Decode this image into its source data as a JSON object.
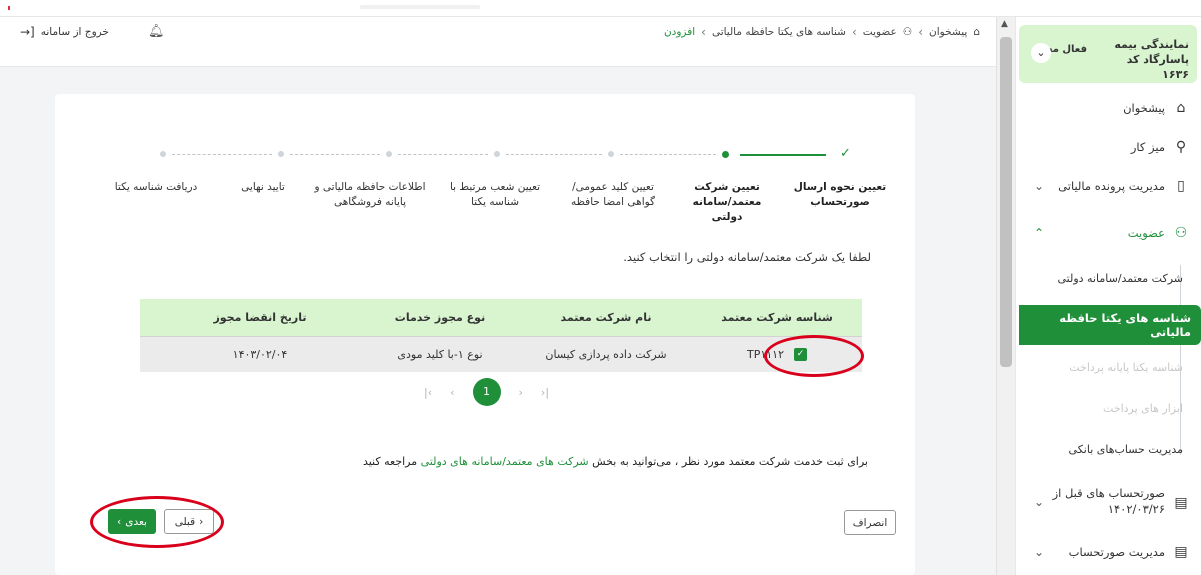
{
  "sidebar": {
    "agency_name": "نمایندگی بیمه پاسارگاد کد ۱۶۳۶",
    "agency_role": "فعال مجاز",
    "items": [
      {
        "label": "پیشخوان",
        "icon": "home-icon"
      },
      {
        "label": "میز کار",
        "icon": "workspace-icon"
      },
      {
        "label": "مدیریت پرونده مالیاتی",
        "icon": "file-icon"
      },
      {
        "label": "عضویت",
        "icon": "user-icon"
      },
      {
        "label": "صورتحساب های قبل از ۱۴۰۲/۰۳/۲۶",
        "icon": "invoice-icon"
      },
      {
        "label": "مدیریت صورتحساب",
        "icon": "invoice-icon"
      }
    ],
    "sub_items": [
      {
        "label": "شرکت معتمد/سامانه دولتی"
      },
      {
        "label": "شناسه های یکتا حافظه مالیاتی"
      },
      {
        "label": "شناسه یکتا پایانه پرداخت"
      },
      {
        "label": "ابزار های پرداخت"
      },
      {
        "label": "مدیریت حساب‌های بانکی"
      }
    ]
  },
  "header": {
    "logout_label": "خروج از سامانه",
    "breadcrumb": [
      "پیشخوان",
      "عضویت",
      "شناسه های یکتا حافظه مالیاتی",
      "افزودن"
    ]
  },
  "steps": [
    "تعیین نحوه ارسال صورتحساب",
    "تعیین شرکت معتمد/سامانه دولتی",
    "تعیین کلید عمومی/گواهی امضا حافظه",
    "تعیین شعب مرتبط با شناسه یکتا",
    "اطلاعات حافظه مالیاتی و پایانه فروشگاهی",
    "تایید نهایی",
    "دریافت شناسه یکتا"
  ],
  "instruction": "لطفا یک شرکت معتمد/سامانه دولتی را انتخاب کنید.",
  "table": {
    "headers": [
      "شناسه شرکت معتمد",
      "نام شرکت معتمد",
      "نوع مجوز خدمات",
      "تاریخ انقضا مجوز"
    ],
    "rows": [
      [
        "TP۱۱۱۲",
        "شرکت داده پردازی کیسان",
        "نوع ۱-با کلید مودی",
        "۱۴۰۳/۰۲/۰۴"
      ]
    ]
  },
  "pagination": {
    "current": "1"
  },
  "note": {
    "before": "برای ثبت خدمت شرکت معتمد مورد نظر ، می‌توانید به بخش",
    "link": "شرکت های معتمد/سامانه های دولتی",
    "after": "مراجعه کنید"
  },
  "buttons": {
    "next": "بعدی",
    "prev": "قبلی",
    "cancel": "انصراف"
  },
  "colors": {
    "accent": "#1f8f3a",
    "light_green": "#d9f5d0",
    "highlight": "#d9001b"
  }
}
